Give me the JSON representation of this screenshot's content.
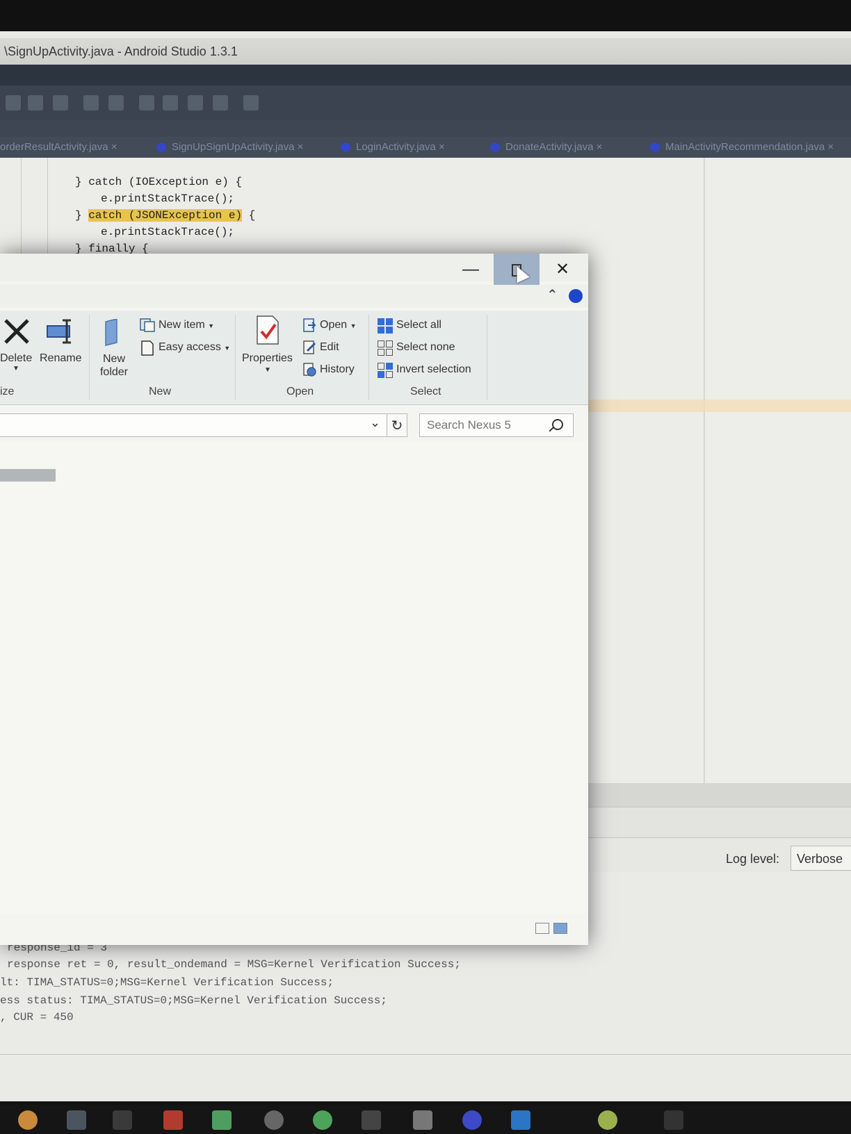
{
  "studio": {
    "title": "\\SignUpActivity.java - Android Studio 1.3.1",
    "tabs": [
      "orderResultActivity.java ×",
      "SignUpSignUpActivity.java ×",
      "LoginActivity.java ×",
      "DonateActivity.java ×",
      "MainActivityRecommendation.java ×"
    ],
    "code_lines": [
      "} catch (IOException e) {",
      "e.printStackTrace();",
      "} ",
      "catch (JSONException e)",
      " {",
      "e.printStackTrace();",
      "} finally {"
    ],
    "log_level_label": "Log level:",
    "log_level_value": "Verbose",
    "log_lines": [
      "response_id = 3",
      "response ret = 0, result_ondemand = MSG=Kernel Verification Success;",
      "lt: TIMA_STATUS=0;MSG=Kernel Verification Success;",
      "ess status: TIMA_STATUS=0;MSG=Kernel Verification Success;",
      ", CUR = 450"
    ]
  },
  "explorer": {
    "window_controls": {
      "minimize": "—",
      "close": "✕"
    },
    "ribbon": {
      "organize": {
        "delete": "Delete",
        "rename": "Rename",
        "group": "ize"
      },
      "new": {
        "new_folder_line1": "New",
        "new_folder_line2": "folder",
        "new_item": "New item",
        "easy_access": "Easy access",
        "group": "New"
      },
      "open": {
        "properties": "Properties",
        "open": "Open",
        "edit": "Edit",
        "history": "History",
        "group": "Open"
      },
      "select": {
        "select_all": "Select all",
        "select_none": "Select none",
        "invert_selection": "Invert selection",
        "group": "Select"
      }
    },
    "search": {
      "placeholder": "Search Nexus 5"
    },
    "icons": {
      "delete": "delete-x-icon",
      "rename": "rename-icon",
      "search": "magnifier-icon",
      "refresh": "refresh-icon"
    },
    "colors": {
      "accent": "#1e46c8",
      "maximize_hover": "#9fb1c6"
    }
  }
}
